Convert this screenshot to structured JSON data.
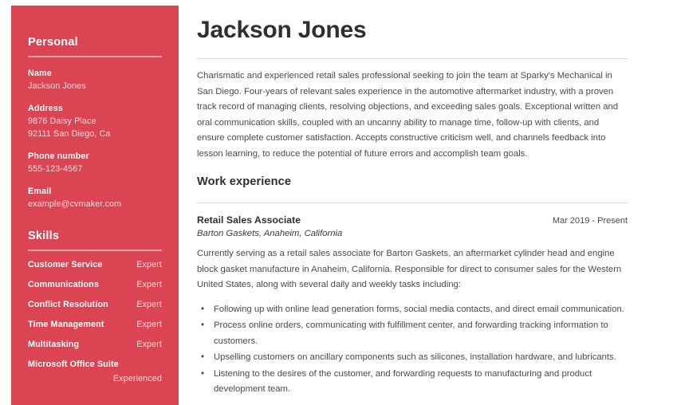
{
  "accent_color": "#db4453",
  "sidebar": {
    "personal": {
      "title": "Personal",
      "fields": [
        {
          "label": "Name",
          "lines": [
            "Jackson Jones"
          ]
        },
        {
          "label": "Address",
          "lines": [
            "9876 Daisy Place",
            "92111 San Diego, Ca"
          ]
        },
        {
          "label": "Phone number",
          "lines": [
            "555-123-4567"
          ]
        },
        {
          "label": "Email",
          "lines": [
            "example@cvmaker.com"
          ]
        }
      ]
    },
    "skills": {
      "title": "Skills",
      "items": [
        {
          "name": "Customer Service",
          "level": "Expert"
        },
        {
          "name": "Communications",
          "level": "Expert"
        },
        {
          "name": "Conflict Resolution",
          "level": "Expert"
        },
        {
          "name": "Time Management",
          "level": "Expert"
        },
        {
          "name": "Multitasking",
          "level": "Expert"
        },
        {
          "name": "Microsoft Office Suite",
          "level": "Experienced"
        }
      ]
    }
  },
  "main": {
    "name": "Jackson Jones",
    "summary": "Charismatic and experienced retail sales professional seeking to join the team at Sparky's Mechanical in San Diego. Four-years of relevant sales experience in the automotive aftermarket industry, with a proven track record of managing clients, resolving objections, and exceeding sales goals. Exceptional written and oral communication skills, coupled with an uncanny ability to manage time, follow-up with clients, and ensure complete customer satisfaction. Accepts constructive criticism well, and channels feedback into lesson learning, to reduce the potential of future errors and accomplish team goals.",
    "work_experience": {
      "heading": "Work experience",
      "jobs": [
        {
          "title": "Retail Sales Associate",
          "dates": "Mar 2019 - Present",
          "company": "Barton Gaskets, Anaheim, California",
          "description": "Currently serving as a retail sales associate for Barton Gaskets, an aftermarket cylinder head and engine block gasket manufacture in Anaheim, California. Responsible for direct to consumer sales for the Western United States, along with several daily and weekly tasks including:",
          "bullets": [
            "Following up with online lead generation forms, social media contacts, and direct email communication.",
            "Process online orders, communicating with fulfillment center, and forwarding tracking information to customers.",
            "Upselling customers on ancillary components such as silicones, installation hardware, and lubricants.",
            "Listening to the desires of the customer, and forwarding requests to manufacturing and product development team."
          ]
        }
      ]
    }
  }
}
